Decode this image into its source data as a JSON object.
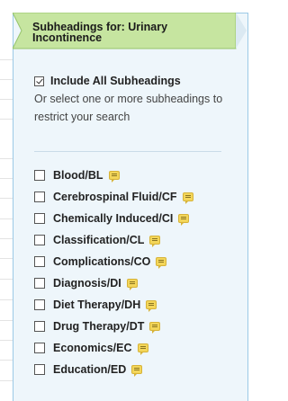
{
  "panel": {
    "title": "Subheadings for: Urinary Incontinence",
    "include_all_label": "Include All Subheadings",
    "include_all_checked": true,
    "instructions": "Or select one or more subheadings to restrict your search"
  },
  "subheadings": [
    {
      "label": "Blood/BL",
      "icon": "note-icon",
      "checked": false
    },
    {
      "label": "Cerebrospinal Fluid/CF",
      "icon": "note-icon",
      "checked": false
    },
    {
      "label": "Chemically Induced/CI",
      "icon": "note-icon",
      "checked": false
    },
    {
      "label": "Classification/CL",
      "icon": "note-icon",
      "checked": false
    },
    {
      "label": "Complications/CO",
      "icon": "note-icon",
      "checked": false
    },
    {
      "label": "Diagnosis/DI",
      "icon": "note-icon",
      "checked": false
    },
    {
      "label": "Diet Therapy/DH",
      "icon": "note-icon",
      "checked": false
    },
    {
      "label": "Drug Therapy/DT",
      "icon": "note-icon",
      "checked": false
    },
    {
      "label": "Economics/EC",
      "icon": "note-icon",
      "checked": false
    },
    {
      "label": "Education/ED",
      "icon": "note-icon",
      "checked": false
    }
  ],
  "colors": {
    "panel_bg": "#eef6fb",
    "panel_border": "#9cc9e6",
    "header_green": "#c6e5a0",
    "note_yellow": "#f3d65a"
  }
}
